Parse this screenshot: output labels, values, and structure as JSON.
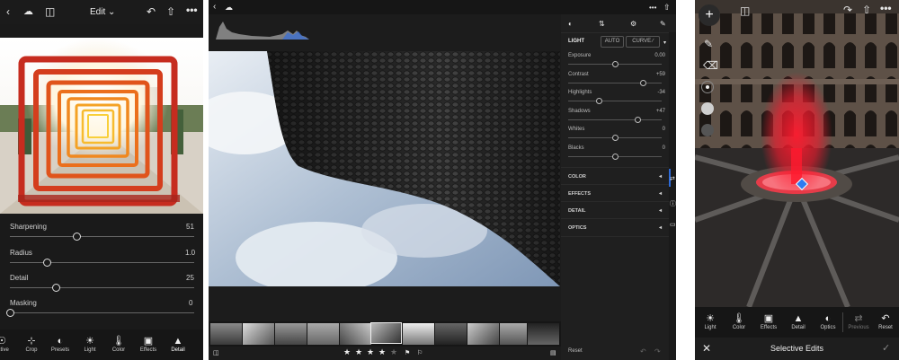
{
  "panel1": {
    "title": "Edit",
    "sliders": [
      {
        "label": "Sharpening",
        "value": "51",
        "level": 0.36
      },
      {
        "label": "Radius",
        "value": "1.0",
        "level": 0.2
      },
      {
        "label": "Detail",
        "value": "25",
        "level": 0.25
      },
      {
        "label": "Masking",
        "value": "0",
        "level": 0.0
      }
    ],
    "tools": [
      "ective",
      "Crop",
      "Presets",
      "Light",
      "Color",
      "Effects",
      "Detail"
    ],
    "active_tool": "Detail",
    "icons": [
      "back-chevron-icon",
      "cloud-sync-icon",
      "compare-icon",
      "undo-icon",
      "share-icon",
      "more-icon"
    ]
  },
  "panel2": {
    "side_tabs": [
      "adjust-icon",
      "info-icon",
      "comment-icon"
    ],
    "light": {
      "header": "LIGHT",
      "auto": "AUTO",
      "curve": "CURVE",
      "sliders": [
        {
          "label": "Exposure",
          "value": "0.00",
          "level": 0.5
        },
        {
          "label": "Contrast",
          "value": "+59",
          "level": 0.8
        },
        {
          "label": "Highlights",
          "value": "-34",
          "level": 0.33
        },
        {
          "label": "Shadows",
          "value": "+47",
          "level": 0.74
        },
        {
          "label": "Whites",
          "value": "0",
          "level": 0.5
        },
        {
          "label": "Blacks",
          "value": "0",
          "level": 0.5
        }
      ]
    },
    "sections": [
      "COLOR",
      "EFFECTS",
      "DETAIL",
      "OPTICS"
    ],
    "reset": "Reset",
    "rating": 4,
    "rating_max": 5,
    "accent": "#2e6bd8"
  },
  "panel3": {
    "tools": [
      "Light",
      "Color",
      "Effects",
      "Detail",
      "Optics",
      "Previous",
      "Reset"
    ],
    "footer_title": "Selective Edits",
    "mask_color": "#ff1a2e",
    "pin_color": "#2f7bf0"
  }
}
